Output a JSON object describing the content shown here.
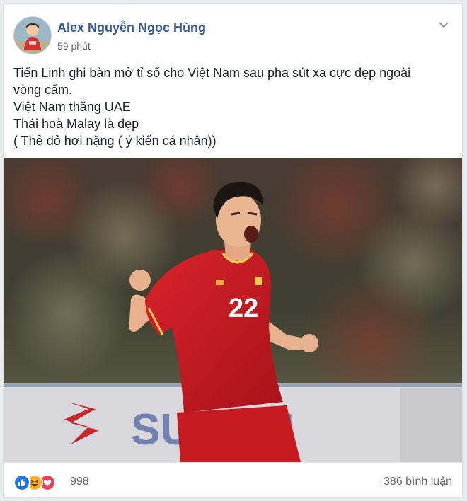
{
  "post": {
    "author": "Alex Nguyễn Ngọc Hùng",
    "time": "59 phút",
    "lines": [
      "Tiến Linh ghi bàn mở tỉ số cho Việt Nam sau pha sút xa cực đẹp ngoài",
      "vòng cấm.",
      "Việt Nam thắng UAE",
      "Thái hoà Malay là đẹp",
      "( Thẻ đỏ hơi nặng ( ý kiến cá nhân))"
    ],
    "photo": {
      "jersey_number": "22",
      "banner_text": "SUZUKI"
    }
  },
  "footer": {
    "reaction_count": "998",
    "comment_count": "386 bình luận"
  },
  "colors": {
    "author_link": "#365899",
    "like_blue": "#1877f2",
    "haha_yellow": "#f7b125",
    "love_red": "#f33e58",
    "jersey_red": "#c8171f"
  },
  "icons": [
    "chevron-down-icon",
    "like-icon",
    "haha-icon",
    "love-icon"
  ]
}
